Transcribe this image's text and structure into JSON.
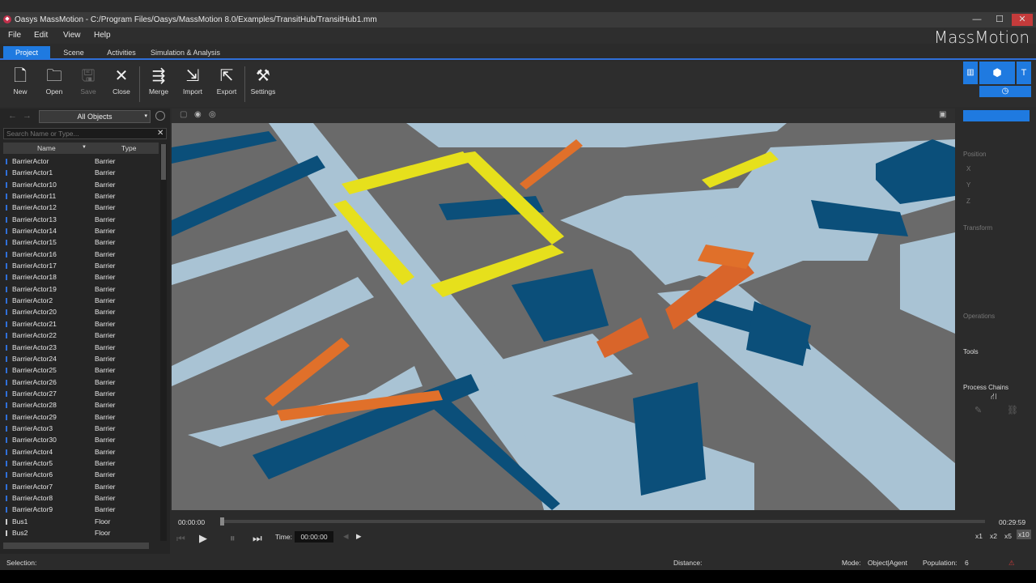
{
  "window": {
    "title": "Oasys MassMotion - C:/Program Files/Oasys/MassMotion 8.0/Examples/TransitHub/TransitHub1.mm",
    "minimize": "—",
    "maximize": "☐",
    "close": "✕"
  },
  "menu": [
    "File",
    "Edit",
    "View",
    "Help"
  ],
  "brand": "MassMotion",
  "tabs": [
    "Project",
    "Scene",
    "Activities",
    "Simulation & Analysis"
  ],
  "ribbon": [
    {
      "label": "New",
      "icon": "new-file-icon",
      "glyph": "🗋"
    },
    {
      "label": "Open",
      "icon": "open-folder-icon",
      "glyph": "🗀"
    },
    {
      "label": "Save",
      "icon": "save-icon",
      "glyph": "🖫"
    },
    {
      "label": "Close",
      "icon": "close-icon",
      "glyph": "✕"
    },
    {
      "label": "Merge",
      "icon": "merge-icon",
      "glyph": "⇶"
    },
    {
      "label": "Import",
      "icon": "import-icon",
      "glyph": "⇲"
    },
    {
      "label": "Export",
      "icon": "export-icon",
      "glyph": "⇱"
    },
    {
      "label": "Settings",
      "icon": "settings-icon",
      "glyph": "⚒"
    }
  ],
  "objects_panel": {
    "filter": "All Objects",
    "search_placeholder": "Search Name or Type...",
    "col_name": "Name",
    "col_type": "Type",
    "rows": [
      {
        "name": "BarrierActor",
        "type": "Barrier"
      },
      {
        "name": "BarrierActor1",
        "type": "Barrier"
      },
      {
        "name": "BarrierActor10",
        "type": "Barrier"
      },
      {
        "name": "BarrierActor11",
        "type": "Barrier"
      },
      {
        "name": "BarrierActor12",
        "type": "Barrier"
      },
      {
        "name": "BarrierActor13",
        "type": "Barrier"
      },
      {
        "name": "BarrierActor14",
        "type": "Barrier"
      },
      {
        "name": "BarrierActor15",
        "type": "Barrier"
      },
      {
        "name": "BarrierActor16",
        "type": "Barrier"
      },
      {
        "name": "BarrierActor17",
        "type": "Barrier"
      },
      {
        "name": "BarrierActor18",
        "type": "Barrier"
      },
      {
        "name": "BarrierActor19",
        "type": "Barrier"
      },
      {
        "name": "BarrierActor2",
        "type": "Barrier"
      },
      {
        "name": "BarrierActor20",
        "type": "Barrier"
      },
      {
        "name": "BarrierActor21",
        "type": "Barrier"
      },
      {
        "name": "BarrierActor22",
        "type": "Barrier"
      },
      {
        "name": "BarrierActor23",
        "type": "Barrier"
      },
      {
        "name": "BarrierActor24",
        "type": "Barrier"
      },
      {
        "name": "BarrierActor25",
        "type": "Barrier"
      },
      {
        "name": "BarrierActor26",
        "type": "Barrier"
      },
      {
        "name": "BarrierActor27",
        "type": "Barrier"
      },
      {
        "name": "BarrierActor28",
        "type": "Barrier"
      },
      {
        "name": "BarrierActor29",
        "type": "Barrier"
      },
      {
        "name": "BarrierActor3",
        "type": "Barrier"
      },
      {
        "name": "BarrierActor30",
        "type": "Barrier"
      },
      {
        "name": "BarrierActor4",
        "type": "Barrier"
      },
      {
        "name": "BarrierActor5",
        "type": "Barrier"
      },
      {
        "name": "BarrierActor6",
        "type": "Barrier"
      },
      {
        "name": "BarrierActor7",
        "type": "Barrier"
      },
      {
        "name": "BarrierActor8",
        "type": "Barrier"
      },
      {
        "name": "BarrierActor9",
        "type": "Barrier"
      },
      {
        "name": "Bus1",
        "type": "Floor"
      },
      {
        "name": "Bus2",
        "type": "Floor"
      }
    ]
  },
  "timeline": {
    "start": "00:00:00",
    "end": "00:29:59",
    "time_label": "Time:",
    "time_value": "00:00:00",
    "speeds": [
      "x1",
      "x2",
      "x5",
      "x10"
    ],
    "progress": 0
  },
  "right_panel": {
    "position": "Position",
    "x": "X",
    "y": "Y",
    "z": "Z",
    "transform": "Transform",
    "operations": "Operations",
    "tools": "Tools",
    "process_chains": "Process Chains"
  },
  "status": {
    "selection": "Selection:",
    "distance": "Distance:",
    "mode_label": "Mode:",
    "mode_value": "Object|Agent",
    "population_label": "Population:",
    "population_value": "6"
  },
  "colors": {
    "accent": "#1f7ae0",
    "barrier": "#0b4f7a",
    "floor": "#a9c3d4",
    "link": "#e6e01c",
    "stair": "#e0702a",
    "ground": "#6a6a6a"
  }
}
